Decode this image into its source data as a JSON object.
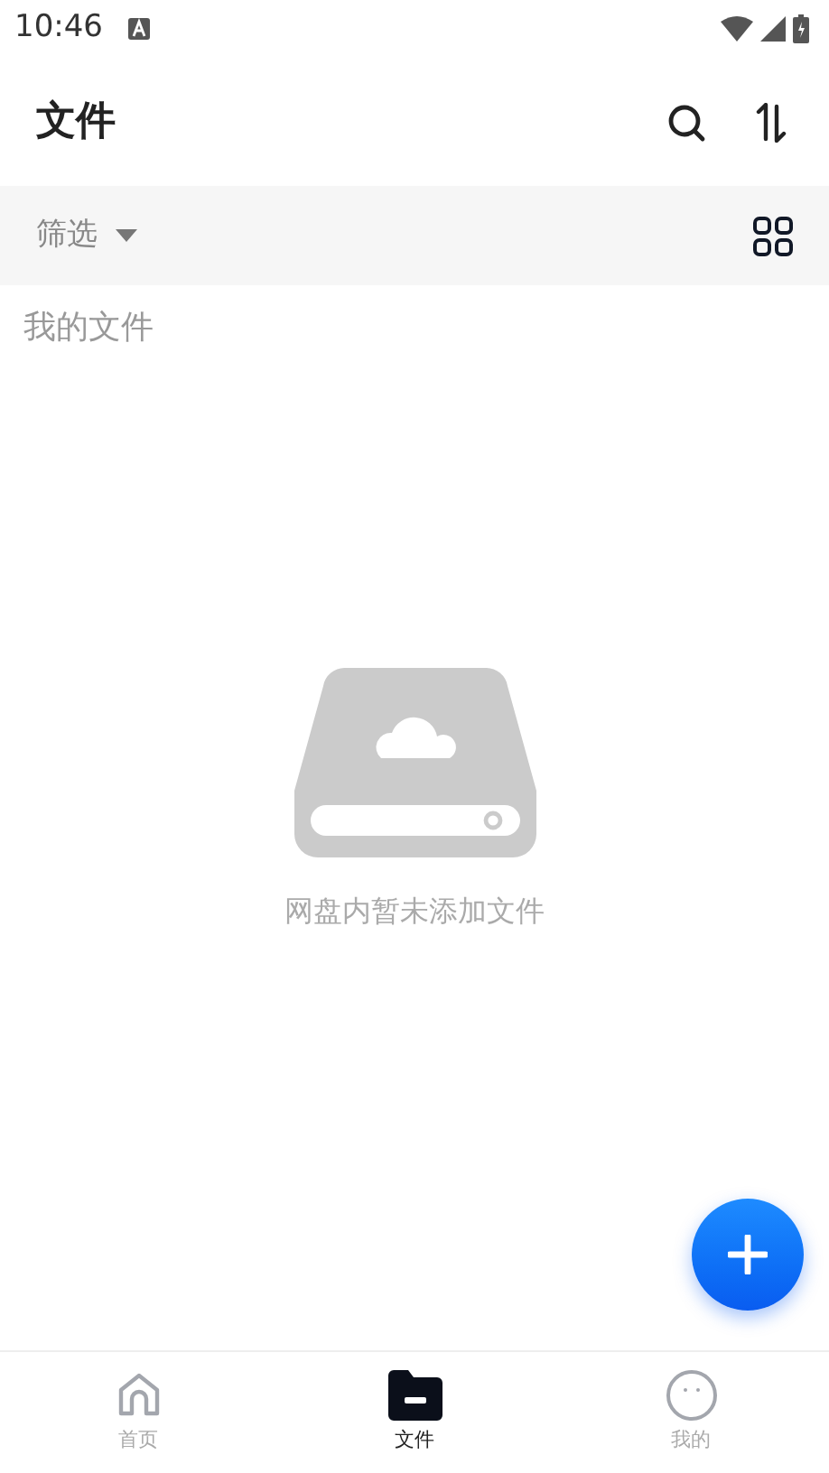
{
  "status_bar": {
    "time": "10:46"
  },
  "header": {
    "title": "文件"
  },
  "filter_bar": {
    "filter_label": "筛选"
  },
  "breadcrumb": "我的文件",
  "empty_state": {
    "message": "网盘内暂未添加文件"
  },
  "bottom_nav": [
    {
      "label": "首页",
      "selected": false,
      "kind": "home"
    },
    {
      "label": "文件",
      "selected": true,
      "kind": "files"
    },
    {
      "label": "我的",
      "selected": false,
      "kind": "me"
    }
  ]
}
